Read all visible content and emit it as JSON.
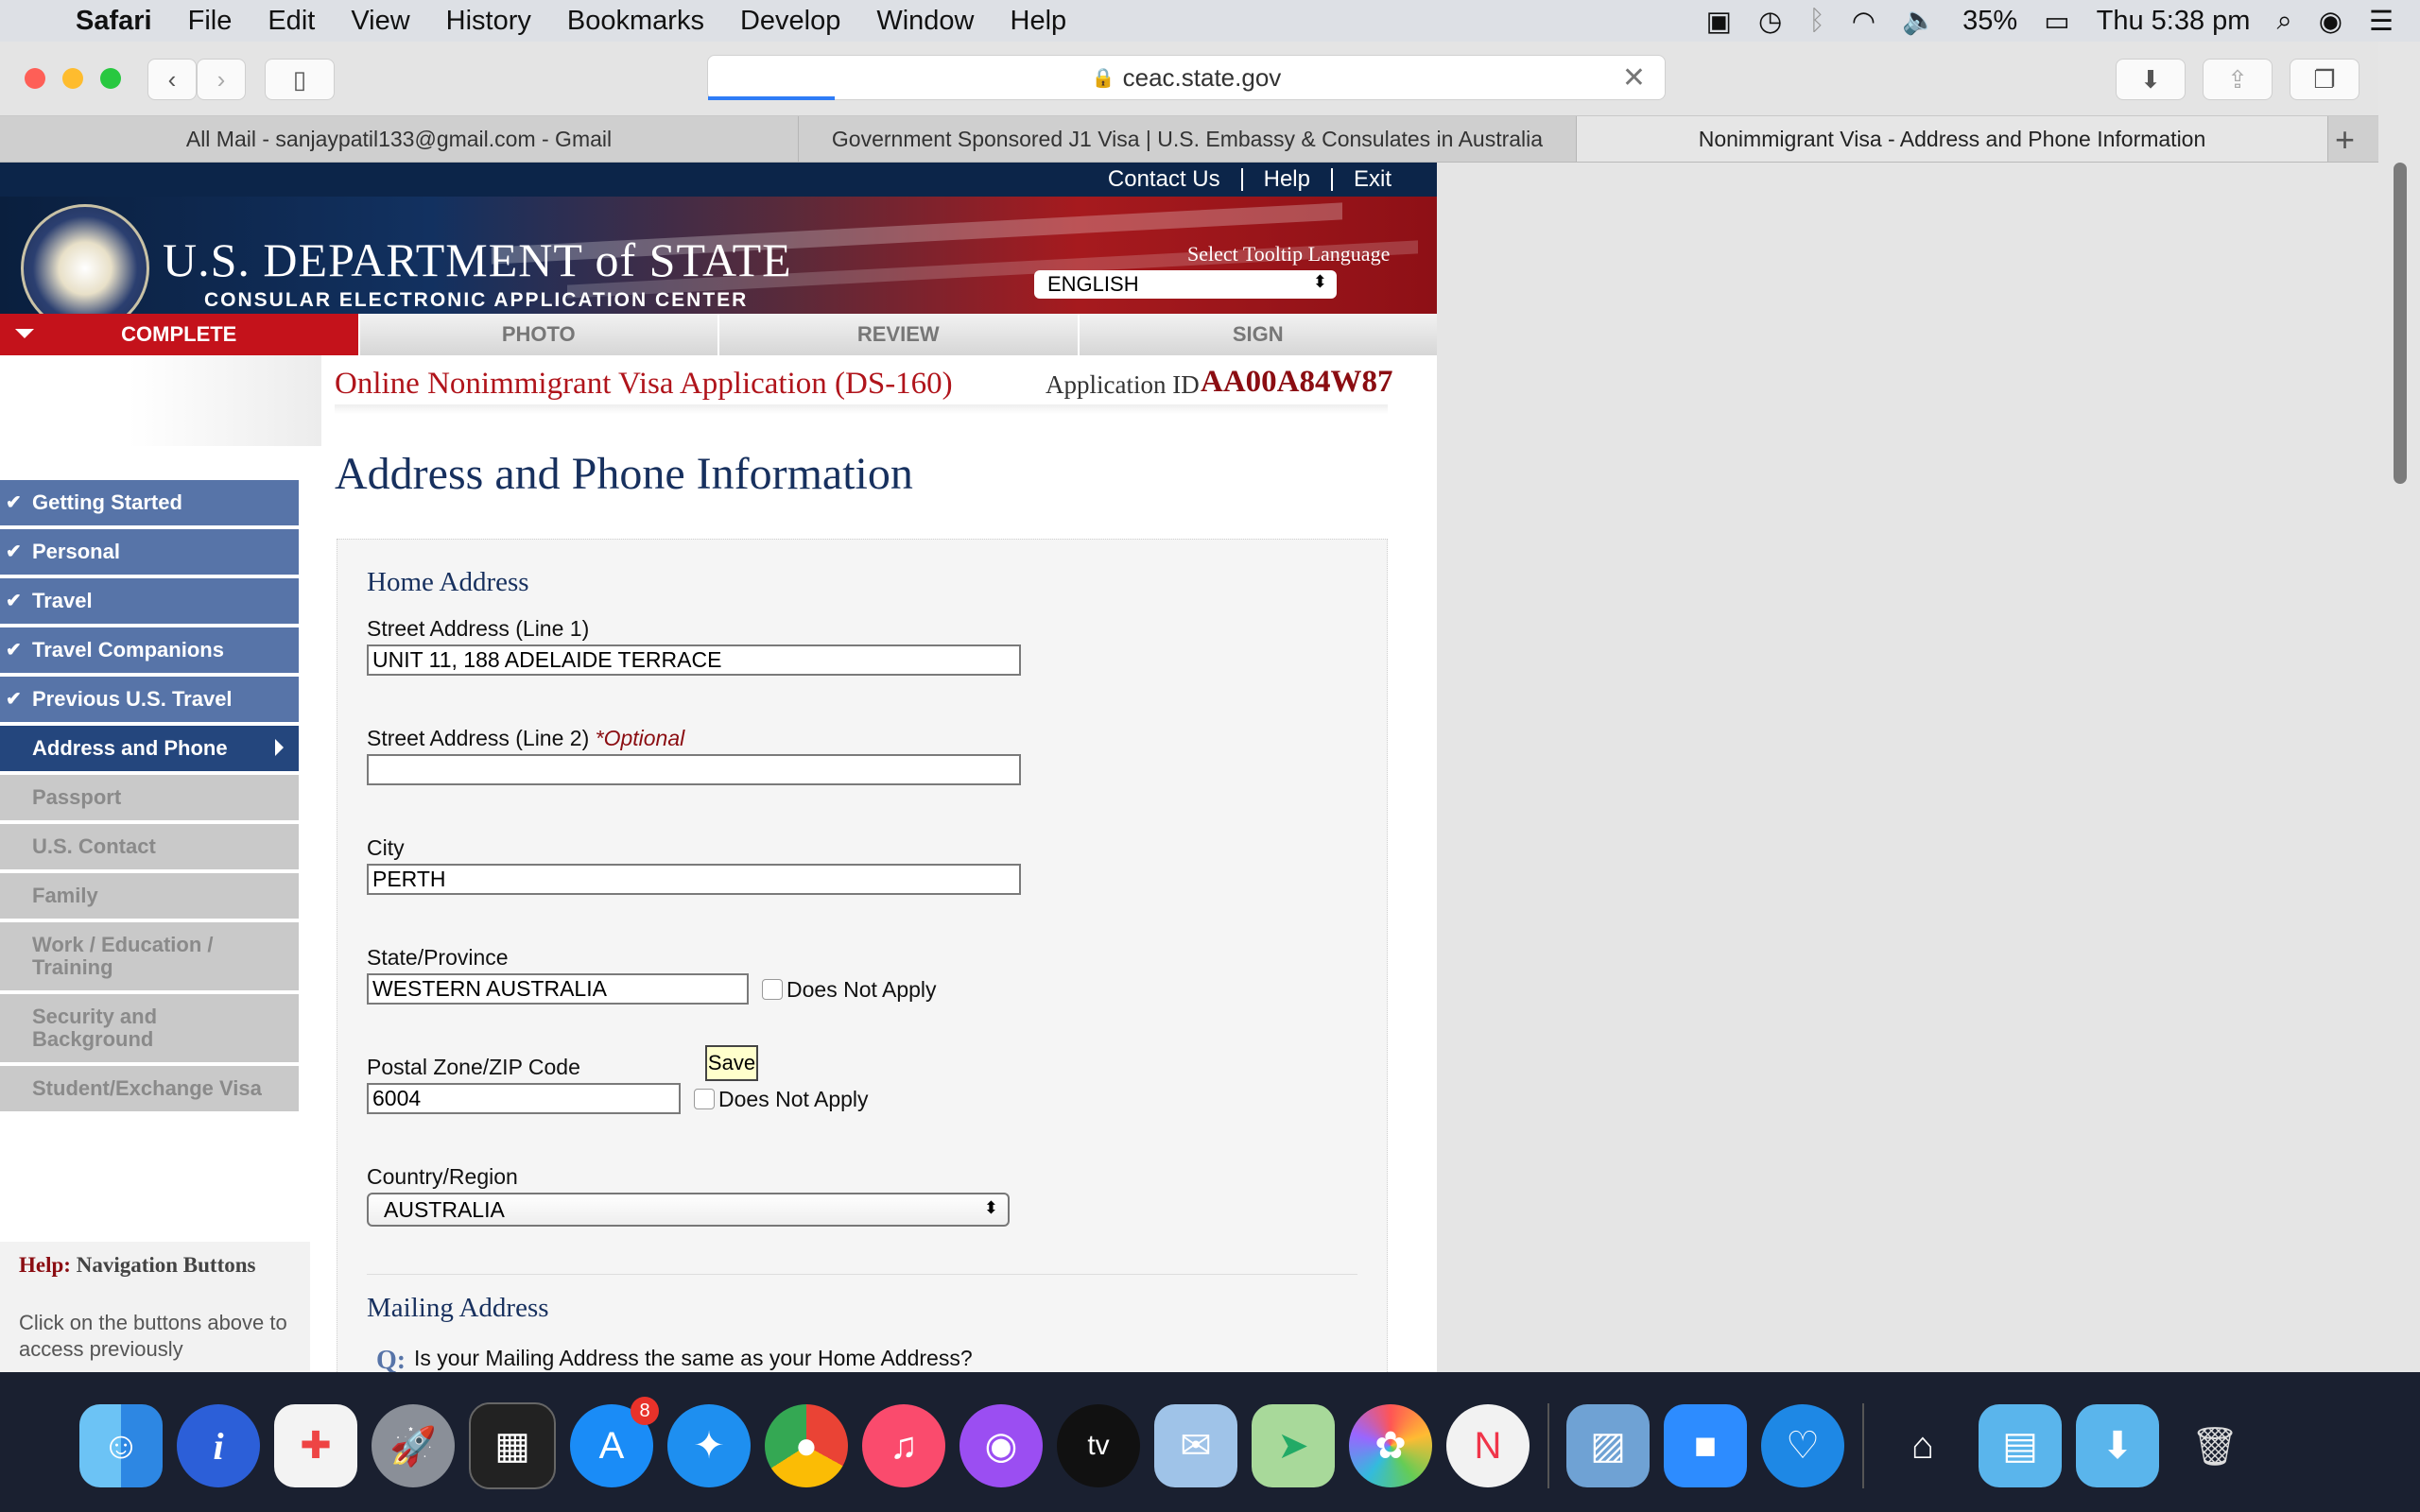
{
  "menubar": {
    "apple": "",
    "app": "Safari",
    "items": [
      "File",
      "Edit",
      "View",
      "History",
      "Bookmarks",
      "Develop",
      "Window",
      "Help"
    ],
    "battery": "35%",
    "clock": "Thu 5:38 pm"
  },
  "browser": {
    "url": "ceac.state.gov",
    "tabs": [
      "All Mail - sanjaypatil133@gmail.com - Gmail",
      "Government Sponsored J1 Visa | U.S. Embassy & Consulates in Australia",
      "Nonimmigrant Visa - Address and Phone Information"
    ]
  },
  "site": {
    "top_links": [
      "Contact Us",
      "Help",
      "Exit"
    ],
    "dept_name": "U.S. DEPARTMENT of STATE",
    "dept_sub": "CONSULAR ELECTRONIC APPLICATION CENTER",
    "lang_label": "Select Tooltip Language",
    "lang_value": "ENGLISH",
    "steps": [
      "COMPLETE",
      "PHOTO",
      "REVIEW",
      "SIGN"
    ],
    "app_title": "Online Nonimmigrant Visa Application (DS-160)",
    "app_id_label": "Application ID",
    "app_id": "AA00A84W87",
    "page_title": "Address and Phone Information"
  },
  "nav": {
    "items": [
      {
        "label": "Getting Started"
      },
      {
        "label": "Personal"
      },
      {
        "label": "Travel"
      },
      {
        "label": "Travel Companions"
      },
      {
        "label": "Previous U.S. Travel"
      },
      {
        "label": "Address and Phone"
      },
      {
        "label": "Passport"
      },
      {
        "label": "U.S. Contact"
      },
      {
        "label": "Family"
      },
      {
        "label": "Work / Education / Training"
      },
      {
        "label": "Security and Background"
      },
      {
        "label": "Student/Exchange Visa"
      }
    ]
  },
  "help": {
    "label": "Help:",
    "title": "Navigation Buttons",
    "text": "Click on the buttons above to access previously"
  },
  "form": {
    "home_header": "Home Address",
    "street1_label": "Street Address (Line 1)",
    "street1_value": "UNIT 11, 188 ADELAIDE TERRACE",
    "street2_label": "Street Address (Line 2)",
    "optional": "*Optional",
    "street2_value": "",
    "city_label": "City",
    "city_value": "PERTH",
    "state_label": "State/Province",
    "state_value": "WESTERN AUSTRALIA",
    "does_not_apply": "Does Not Apply",
    "postal_label": "Postal Zone/ZIP Code",
    "postal_value": "6004",
    "save_tooltip": "Save",
    "country_label": "Country/Region",
    "country_value": "AUSTRALIA",
    "mailing_header": "Mailing Address",
    "q_icon": "Q:",
    "mailing_question": "Is your Mailing Address the same as your Home Address?"
  },
  "dock": {
    "appstore_badge": "8",
    "apps": [
      "Finder",
      "Info",
      "Mosaic",
      "Launchpad",
      "Activity",
      "App Store",
      "Safari",
      "Chrome",
      "Music",
      "Podcasts",
      "TV",
      "Mail",
      "Maps",
      "Photos",
      "News",
      "Preview",
      "Zoom",
      "Health",
      "Home",
      "Folder",
      "Downloads",
      "Trash"
    ]
  },
  "colors": {
    "nav_done": "#5774a8",
    "nav_active": "#24467d",
    "nav_pending": "#c9c9c9",
    "step_current": "#c4121b",
    "title_red": "#b0141b",
    "heading_blue": "#17305e"
  }
}
